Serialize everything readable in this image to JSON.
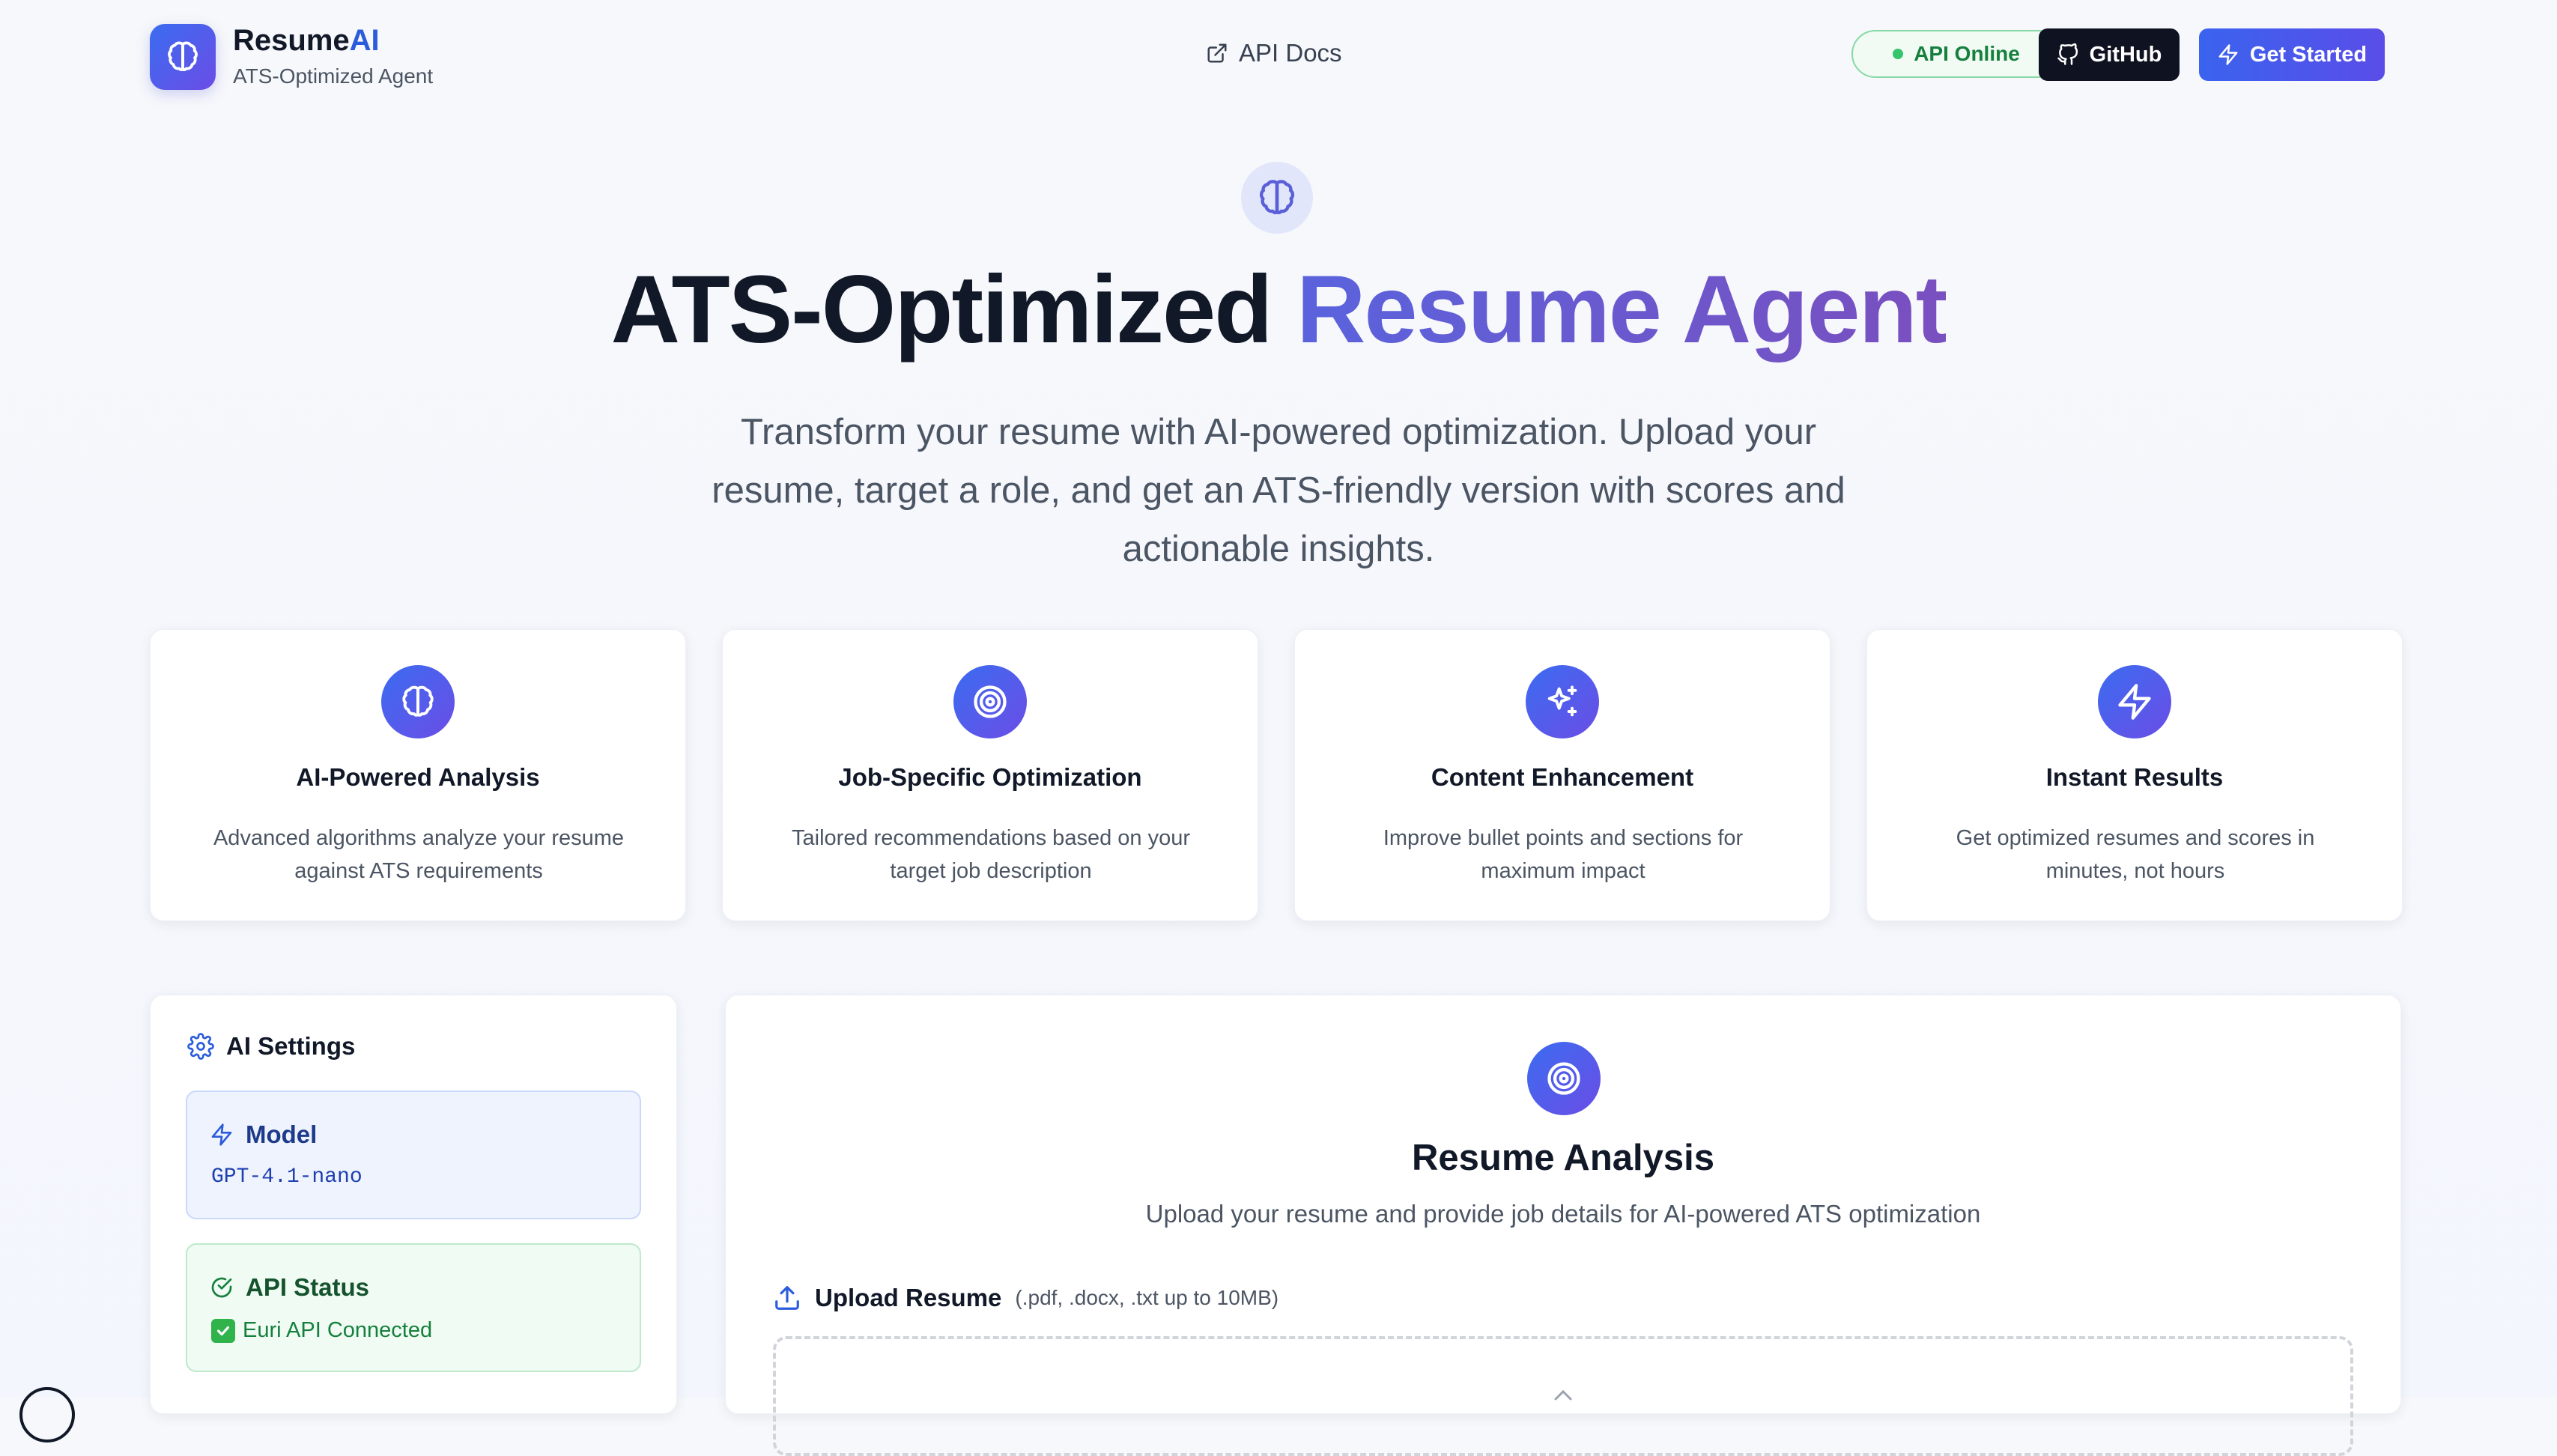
{
  "header": {
    "brand_prefix": "Resume",
    "brand_suffix": "AI",
    "brand_subtitle": "ATS-Optimized Agent",
    "nav_docs": "API Docs",
    "status_badge": "API Online",
    "github_label": "GitHub",
    "cta_label": "Get Started"
  },
  "hero": {
    "title_main": "ATS-Optimized",
    "title_accent": "Resume Agent",
    "description": "Transform your resume with AI-powered optimization. Upload your resume, target a role, and get an ATS-friendly version with scores and actionable insights."
  },
  "features": [
    {
      "icon": "brain-icon",
      "title": "AI-Powered Analysis",
      "desc": "Advanced algorithms analyze your resume against ATS requirements"
    },
    {
      "icon": "target-icon",
      "title": "Job-Specific Optimization",
      "desc": "Tailored recommendations based on your target job description"
    },
    {
      "icon": "sparkles-icon",
      "title": "Content Enhancement",
      "desc": "Improve bullet points and sections for maximum impact"
    },
    {
      "icon": "zap-icon",
      "title": "Instant Results",
      "desc": "Get optimized resumes and scores in minutes, not hours"
    }
  ],
  "settings": {
    "title": "AI Settings",
    "model_label": "Model",
    "model_value": "GPT-4.1-nano",
    "api_label": "API Status",
    "api_value": "Euri API Connected"
  },
  "analysis": {
    "title": "Resume Analysis",
    "subtitle": "Upload your resume and provide job details for AI-powered ATS optimization",
    "upload_label": "Upload Resume",
    "upload_hint": "(.pdf, .docx, .txt up to 10MB)"
  },
  "colors": {
    "accent_blue": "#3b6cf0",
    "accent_violet": "#6b4de6",
    "online_green": "#15803d",
    "dark_button": "#0f1220"
  }
}
